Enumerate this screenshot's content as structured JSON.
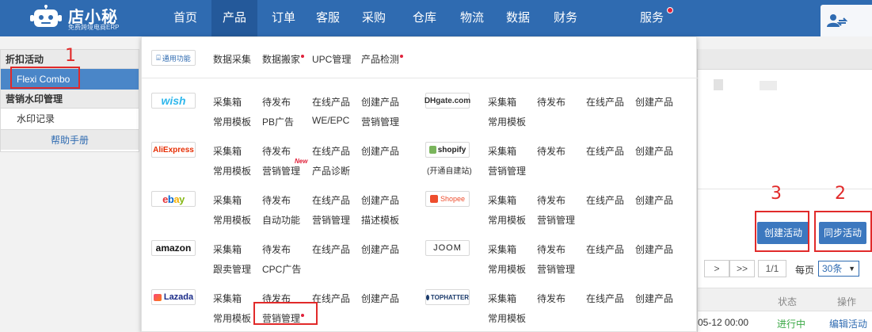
{
  "app": {
    "logo_title": "店小秘",
    "logo_subtitle": "免费跨境电商ERP"
  },
  "nav": {
    "items": [
      "首页",
      "产品",
      "订单",
      "客服",
      "采购",
      "仓库",
      "物流",
      "数据",
      "财务",
      "服务"
    ],
    "active_index": 1
  },
  "sidebar": {
    "section1": "折扣活动",
    "item_flexi": "Flexi Combo",
    "section2": "营销水印管理",
    "item_watermark": "水印记录",
    "help": "帮助手册"
  },
  "dropdown": {
    "general": {
      "logo": "通用功能",
      "links": [
        "数据采集",
        "数据搬家",
        "UPC管理",
        "产品检测"
      ]
    },
    "wish": {
      "logo": "wish",
      "row1": [
        "采集箱",
        "待发布",
        "在线产品",
        "创建产品"
      ],
      "row2": [
        "常用模板",
        "PB广告",
        "WE/EPC",
        "营销管理"
      ]
    },
    "dhgate": {
      "logo": "DHgate.com",
      "row1": [
        "采集箱",
        "待发布",
        "在线产品",
        "创建产品"
      ],
      "row2": [
        "常用模板"
      ]
    },
    "aliexpress": {
      "logo": "AliExpress",
      "row1": [
        "采集箱",
        "待发布",
        "在线产品",
        "创建产品"
      ],
      "row2": [
        "常用模板",
        "营销管理",
        "产品诊断"
      ],
      "new_tag": "New"
    },
    "shopify": {
      "logo": "shopify",
      "sub": "(开通自建站)",
      "row1": [
        "采集箱",
        "待发布",
        "在线产品",
        "创建产品"
      ],
      "row2": [
        "营销管理"
      ]
    },
    "ebay": {
      "logo": "ebay",
      "row1": [
        "采集箱",
        "待发布",
        "在线产品",
        "创建产品"
      ],
      "row2": [
        "常用模板",
        "自动功能",
        "营销管理",
        "描述模板"
      ]
    },
    "shopee": {
      "logo": "Shopee",
      "row1": [
        "采集箱",
        "待发布",
        "在线产品",
        "创建产品"
      ],
      "row2": [
        "常用模板",
        "营销管理"
      ]
    },
    "amazon": {
      "logo": "amazon",
      "row1": [
        "采集箱",
        "待发布",
        "在线产品",
        "创建产品"
      ],
      "row2": [
        "跟卖管理",
        "CPC广告"
      ]
    },
    "joom": {
      "logo": "JOOM",
      "row1": [
        "采集箱",
        "待发布",
        "在线产品",
        "创建产品"
      ],
      "row2": [
        "常用模板",
        "营销管理"
      ]
    },
    "lazada": {
      "logo": "Lazada",
      "row1": [
        "采集箱",
        "待发布",
        "在线产品",
        "创建产品"
      ],
      "row2": [
        "常用模板",
        "营销管理"
      ]
    },
    "tophatter": {
      "logo": "TOPHATTER",
      "row1": [
        "采集箱",
        "待发布",
        "在线产品",
        "创建产品"
      ],
      "row2": [
        "常用模板"
      ]
    }
  },
  "content": {
    "create_button": "创建活动",
    "sync_button": "同步活动",
    "pager": {
      "next": ">",
      "last": ">>",
      "page": "1/1",
      "per_page_label": "每页",
      "per_page_value": "30条"
    },
    "table": {
      "col_status": "状态",
      "col_op": "操作",
      "row_time": "05-12 00:00",
      "row_status": "进行中",
      "row_edit": "编辑活动"
    }
  },
  "annotations": [
    "1",
    "2",
    "3"
  ],
  "colors": {
    "nav_bg": "#2f6bb1",
    "accent": "#3c78bf",
    "annotation_red": "#e12a2a"
  }
}
